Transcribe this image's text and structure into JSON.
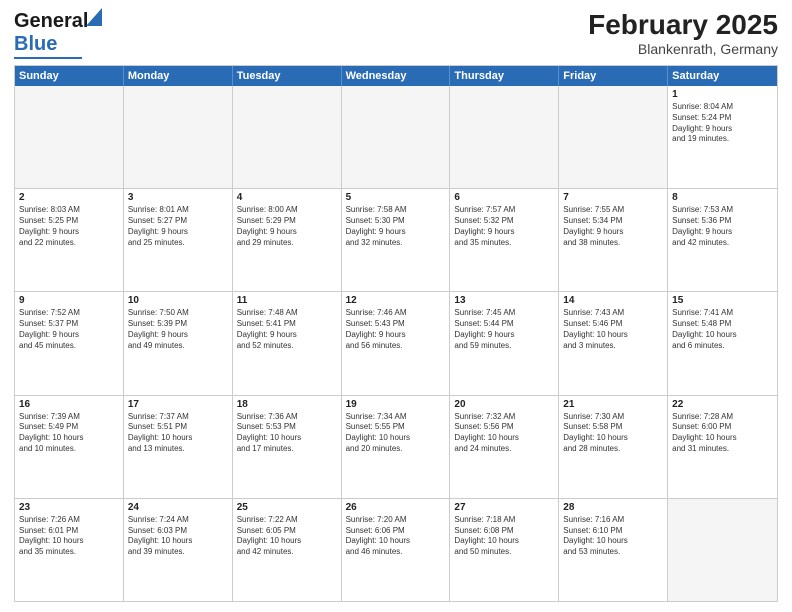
{
  "header": {
    "logo_line1": "General",
    "logo_line2": "Blue",
    "month": "February 2025",
    "location": "Blankenrath, Germany"
  },
  "days_of_week": [
    "Sunday",
    "Monday",
    "Tuesday",
    "Wednesday",
    "Thursday",
    "Friday",
    "Saturday"
  ],
  "weeks": [
    [
      {
        "day": "",
        "text": ""
      },
      {
        "day": "",
        "text": ""
      },
      {
        "day": "",
        "text": ""
      },
      {
        "day": "",
        "text": ""
      },
      {
        "day": "",
        "text": ""
      },
      {
        "day": "",
        "text": ""
      },
      {
        "day": "1",
        "text": "Sunrise: 8:04 AM\nSunset: 5:24 PM\nDaylight: 9 hours\nand 19 minutes."
      }
    ],
    [
      {
        "day": "2",
        "text": "Sunrise: 8:03 AM\nSunset: 5:25 PM\nDaylight: 9 hours\nand 22 minutes."
      },
      {
        "day": "3",
        "text": "Sunrise: 8:01 AM\nSunset: 5:27 PM\nDaylight: 9 hours\nand 25 minutes."
      },
      {
        "day": "4",
        "text": "Sunrise: 8:00 AM\nSunset: 5:29 PM\nDaylight: 9 hours\nand 29 minutes."
      },
      {
        "day": "5",
        "text": "Sunrise: 7:58 AM\nSunset: 5:30 PM\nDaylight: 9 hours\nand 32 minutes."
      },
      {
        "day": "6",
        "text": "Sunrise: 7:57 AM\nSunset: 5:32 PM\nDaylight: 9 hours\nand 35 minutes."
      },
      {
        "day": "7",
        "text": "Sunrise: 7:55 AM\nSunset: 5:34 PM\nDaylight: 9 hours\nand 38 minutes."
      },
      {
        "day": "8",
        "text": "Sunrise: 7:53 AM\nSunset: 5:36 PM\nDaylight: 9 hours\nand 42 minutes."
      }
    ],
    [
      {
        "day": "9",
        "text": "Sunrise: 7:52 AM\nSunset: 5:37 PM\nDaylight: 9 hours\nand 45 minutes."
      },
      {
        "day": "10",
        "text": "Sunrise: 7:50 AM\nSunset: 5:39 PM\nDaylight: 9 hours\nand 49 minutes."
      },
      {
        "day": "11",
        "text": "Sunrise: 7:48 AM\nSunset: 5:41 PM\nDaylight: 9 hours\nand 52 minutes."
      },
      {
        "day": "12",
        "text": "Sunrise: 7:46 AM\nSunset: 5:43 PM\nDaylight: 9 hours\nand 56 minutes."
      },
      {
        "day": "13",
        "text": "Sunrise: 7:45 AM\nSunset: 5:44 PM\nDaylight: 9 hours\nand 59 minutes."
      },
      {
        "day": "14",
        "text": "Sunrise: 7:43 AM\nSunset: 5:46 PM\nDaylight: 10 hours\nand 3 minutes."
      },
      {
        "day": "15",
        "text": "Sunrise: 7:41 AM\nSunset: 5:48 PM\nDaylight: 10 hours\nand 6 minutes."
      }
    ],
    [
      {
        "day": "16",
        "text": "Sunrise: 7:39 AM\nSunset: 5:49 PM\nDaylight: 10 hours\nand 10 minutes."
      },
      {
        "day": "17",
        "text": "Sunrise: 7:37 AM\nSunset: 5:51 PM\nDaylight: 10 hours\nand 13 minutes."
      },
      {
        "day": "18",
        "text": "Sunrise: 7:36 AM\nSunset: 5:53 PM\nDaylight: 10 hours\nand 17 minutes."
      },
      {
        "day": "19",
        "text": "Sunrise: 7:34 AM\nSunset: 5:55 PM\nDaylight: 10 hours\nand 20 minutes."
      },
      {
        "day": "20",
        "text": "Sunrise: 7:32 AM\nSunset: 5:56 PM\nDaylight: 10 hours\nand 24 minutes."
      },
      {
        "day": "21",
        "text": "Sunrise: 7:30 AM\nSunset: 5:58 PM\nDaylight: 10 hours\nand 28 minutes."
      },
      {
        "day": "22",
        "text": "Sunrise: 7:28 AM\nSunset: 6:00 PM\nDaylight: 10 hours\nand 31 minutes."
      }
    ],
    [
      {
        "day": "23",
        "text": "Sunrise: 7:26 AM\nSunset: 6:01 PM\nDaylight: 10 hours\nand 35 minutes."
      },
      {
        "day": "24",
        "text": "Sunrise: 7:24 AM\nSunset: 6:03 PM\nDaylight: 10 hours\nand 39 minutes."
      },
      {
        "day": "25",
        "text": "Sunrise: 7:22 AM\nSunset: 6:05 PM\nDaylight: 10 hours\nand 42 minutes."
      },
      {
        "day": "26",
        "text": "Sunrise: 7:20 AM\nSunset: 6:06 PM\nDaylight: 10 hours\nand 46 minutes."
      },
      {
        "day": "27",
        "text": "Sunrise: 7:18 AM\nSunset: 6:08 PM\nDaylight: 10 hours\nand 50 minutes."
      },
      {
        "day": "28",
        "text": "Sunrise: 7:16 AM\nSunset: 6:10 PM\nDaylight: 10 hours\nand 53 minutes."
      },
      {
        "day": "",
        "text": ""
      }
    ]
  ]
}
